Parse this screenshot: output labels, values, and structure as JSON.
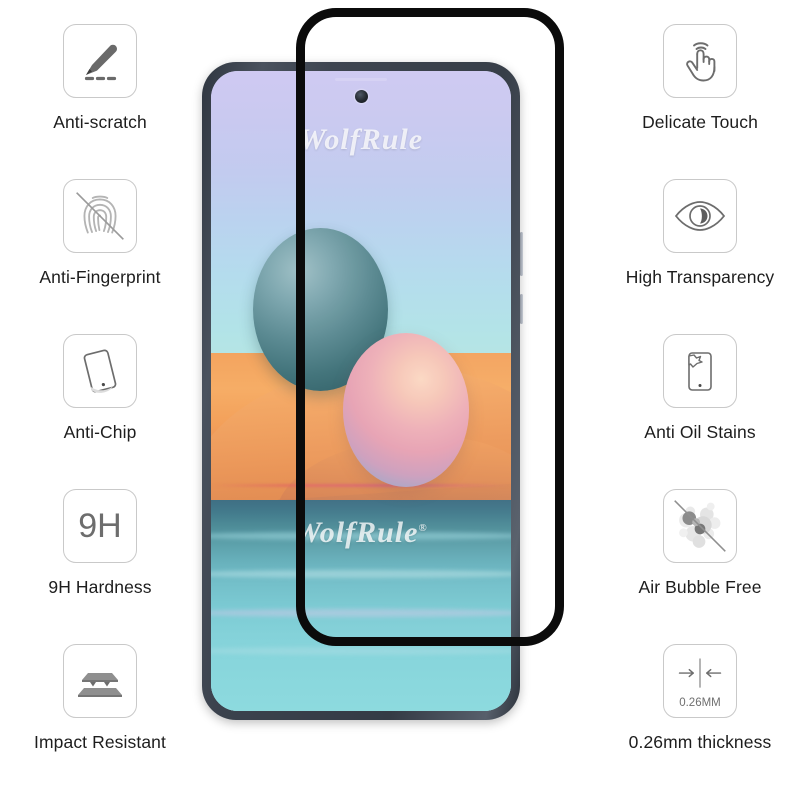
{
  "product": {
    "watermark_top": "WolfRule",
    "watermark_bottom": "WolfRule",
    "watermark_trademark": "®"
  },
  "features_left": [
    {
      "id": "anti-scratch",
      "label": "Anti-scratch",
      "icon": "pencil-scratch-icon"
    },
    {
      "id": "anti-fingerprint",
      "label": "Anti-Fingerprint",
      "icon": "fingerprint-slash-icon"
    },
    {
      "id": "anti-chip",
      "label": "Anti-Chip",
      "icon": "tilted-phone-icon"
    },
    {
      "id": "hardness",
      "label": "9H Hardness",
      "icon": "hardness-9h-icon",
      "icon_text": "9H"
    },
    {
      "id": "impact-resistant",
      "label": "Impact Resistant",
      "icon": "layered-plates-icon"
    }
  ],
  "features_right": [
    {
      "id": "delicate-touch",
      "label": "Delicate Touch",
      "icon": "touch-hand-icon"
    },
    {
      "id": "high-transparency",
      "label": "High Transparency",
      "icon": "eye-icon"
    },
    {
      "id": "anti-oil-stains",
      "label": "Anti Oil Stains",
      "icon": "phone-stain-icon"
    },
    {
      "id": "air-bubble-free",
      "label": "Air Bubble Free",
      "icon": "bubbles-slash-icon"
    },
    {
      "id": "thickness",
      "label": "0.26mm thickness",
      "icon": "thickness-arrows-icon",
      "icon_text": "0.26MM"
    }
  ],
  "colors": {
    "background": "#ffffff",
    "label_text": "#1d1d1d",
    "icon_stroke": "#6d6d6d",
    "icon_box_border": "#c9c9c9",
    "protector_frame": "#0b0b0b",
    "phone_frame": "#3b424d"
  }
}
